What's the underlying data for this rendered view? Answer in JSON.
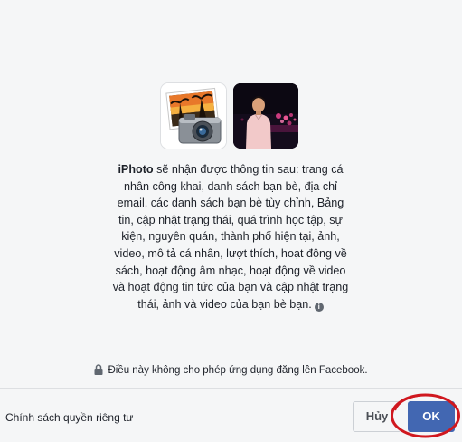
{
  "app": {
    "name": "iPhoto",
    "logo_icon": "iphoto-app-icon",
    "profile_icon": "user-profile-photo"
  },
  "permission_message": {
    "lines": [
      [
        " sẽ nhận được thông tin sau: trang cá"
      ],
      [
        "nhân công khai, danh sách bạn bè, địa chỉ"
      ],
      [
        "email, các danh sách bạn bè tùy chỉnh, Bảng"
      ],
      [
        "tin, cập nhật trạng thái, quá trình học tập, sự"
      ],
      [
        "kiện, nguyên quán, thành phố hiện tại, ảnh,"
      ],
      [
        "video, mô tả cá nhân, lượt thích, hoạt động về"
      ],
      [
        "sách, hoạt động âm nhạc, hoạt động về video"
      ],
      [
        "và hoạt động tin tức của bạn và cập nhật trạng"
      ],
      [
        "thái, ảnh và video của bạn bè bạn."
      ]
    ],
    "info_icon": "info-icon"
  },
  "notice": {
    "text": "Điều này không cho phép ứng dụng đăng lên Facebook.",
    "icon": "lock-icon"
  },
  "footer": {
    "privacy_link": "Chính sách quyền riêng tư",
    "cancel_label": "Hủy",
    "ok_label": "OK"
  },
  "colors": {
    "primary_button": "#4267b2",
    "annotation": "#d0181f",
    "background": "#f5f6f7"
  }
}
